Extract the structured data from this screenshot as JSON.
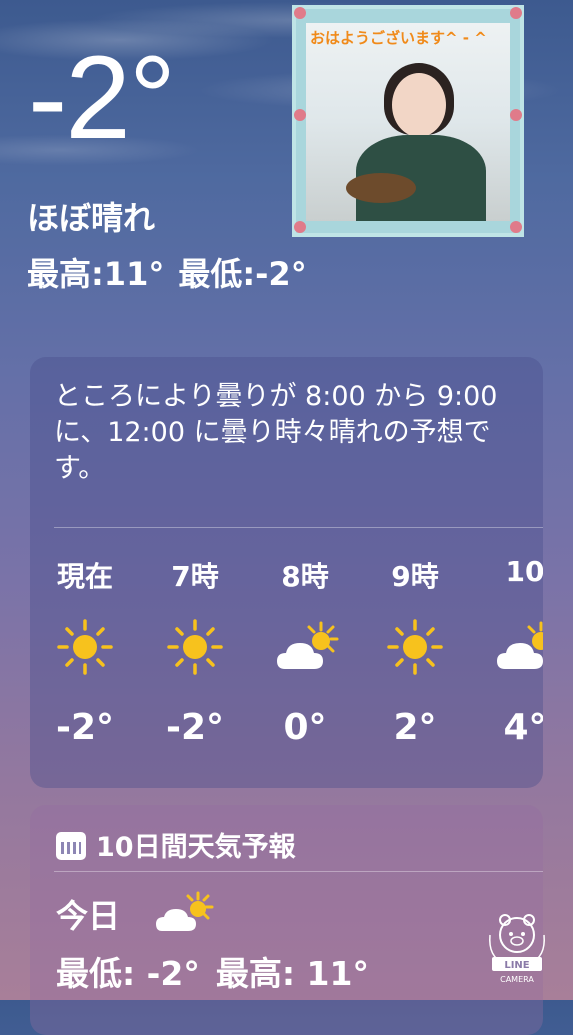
{
  "current": {
    "temperature": "-2°",
    "condition": "ほぼ晴れ",
    "high_label": "最高:11°",
    "low_label": "最低:-2°"
  },
  "photo": {
    "caption": "おはようございます^ - ^"
  },
  "forecast": {
    "summary": "ところにより曇りが 8:00 から 9:00 に、12:00 に曇り時々晴れの予想です。",
    "hours": [
      {
        "label": "現在",
        "icon": "sun-icon",
        "temp": "-2°"
      },
      {
        "label": "7時",
        "icon": "sun-icon",
        "temp": "-2°"
      },
      {
        "label": "8時",
        "icon": "partly-cloudy-icon",
        "temp": "0°"
      },
      {
        "label": "9時",
        "icon": "sun-icon",
        "temp": "2°"
      },
      {
        "label": "10",
        "icon": "partly-cloudy-icon",
        "temp": "4°"
      }
    ]
  },
  "ten_day": {
    "title": "10日間天気予報",
    "today_label": "今日",
    "today_icon": "partly-cloudy-icon",
    "low": "最低: -2°",
    "high": "最高: 11°"
  },
  "watermark": {
    "brand": "LINE",
    "sub": "CAMERA"
  },
  "colors": {
    "sun": "#f7c21d",
    "caption": "#f08a1a"
  }
}
